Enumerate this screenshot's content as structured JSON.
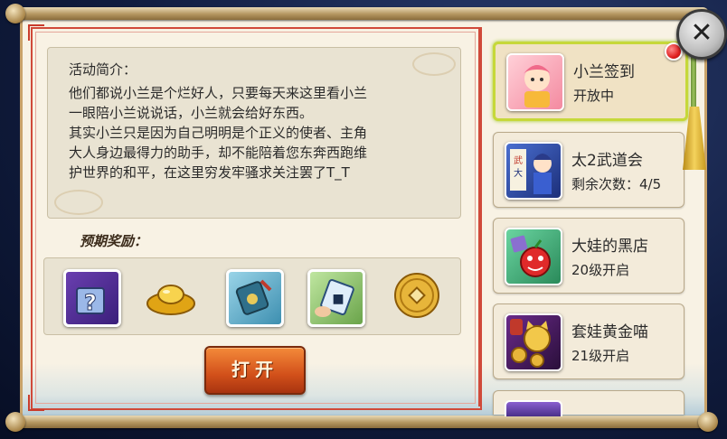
{
  "description": {
    "title": "活动简介：",
    "lines": [
      "他们都说小兰是个烂好人，只要每天来这里看小兰",
      "一眼陪小兰说说话，小兰就会给好东西。",
      "其实小兰只是因为自己明明是个正义的使者、主角",
      "大人身边最得力的助手，却不能陪着您东奔西跑维",
      "护世界的和平，在这里穷发牢骚求关注罢了T_T"
    ]
  },
  "rewards": {
    "label": "预期奖励：",
    "items": [
      "mystery-box-icon",
      "gold-ingot-icon",
      "blue-token-card-icon",
      "scroll-card-icon",
      "copper-coin-icon"
    ]
  },
  "open_button": {
    "label": "打开"
  },
  "sidebar": {
    "items": [
      {
        "name": "小兰签到",
        "status": "开放中",
        "icon": "xiaolan-icon"
      },
      {
        "name": "太2武道会",
        "status": "剩余次数：4/5",
        "icon": "martial-arts-icon"
      },
      {
        "name": "大娃的黑店",
        "status": "20级开启",
        "icon": "shop-icon"
      },
      {
        "name": "套娃黄金喵",
        "status": "21级开启",
        "icon": "golden-cat-icon"
      }
    ]
  },
  "colors": {
    "frame_red": "#d04a3a",
    "button_orange": "#d2501a",
    "active_border": "#c6d83a"
  }
}
